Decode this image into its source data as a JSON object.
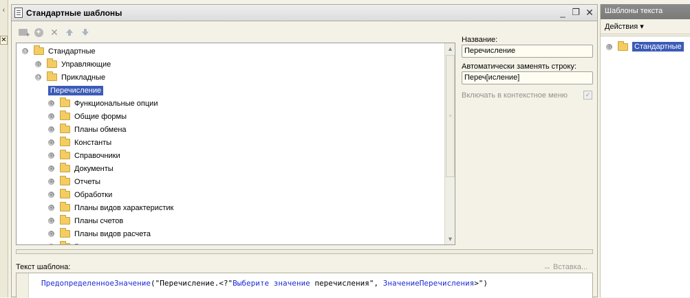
{
  "window": {
    "title": "Стандартные шаблоны",
    "minimize_icon": "_",
    "restore_icon": "❐",
    "close_icon": "✕"
  },
  "left_panel": {
    "collapse_icon": "‹",
    "close_icon": "✕"
  },
  "toolbar": {
    "items": [
      "add-folder-icon",
      "add-icon",
      "delete-icon",
      "move-up-icon",
      "move-down-icon"
    ]
  },
  "tree": {
    "rows": [
      {
        "label": "Стандартные",
        "expander": "⊖",
        "level": 0,
        "folder": true
      },
      {
        "label": "Управляющие",
        "expander": "⊕",
        "level": 1,
        "folder": true
      },
      {
        "label": "Прикладные",
        "expander": "⊖",
        "level": 1,
        "folder": true
      },
      {
        "label": "Перечисление",
        "expander": "",
        "level": 2,
        "folder": false,
        "selected": true
      },
      {
        "label": "Функциональные опции",
        "expander": "⊕",
        "level": 2,
        "folder": true
      },
      {
        "label": "Общие формы",
        "expander": "⊕",
        "level": 2,
        "folder": true
      },
      {
        "label": "Планы обмена",
        "expander": "⊕",
        "level": 2,
        "folder": true
      },
      {
        "label": "Константы",
        "expander": "⊕",
        "level": 2,
        "folder": true
      },
      {
        "label": "Справочники",
        "expander": "⊕",
        "level": 2,
        "folder": true
      },
      {
        "label": "Документы",
        "expander": "⊕",
        "level": 2,
        "folder": true
      },
      {
        "label": "Отчеты",
        "expander": "⊕",
        "level": 2,
        "folder": true
      },
      {
        "label": "Обработки",
        "expander": "⊕",
        "level": 2,
        "folder": true
      },
      {
        "label": "Планы видов характеристик",
        "expander": "⊕",
        "level": 2,
        "folder": true
      },
      {
        "label": "Планы счетов",
        "expander": "⊕",
        "level": 2,
        "folder": true
      },
      {
        "label": "Планы видов расчета",
        "expander": "⊕",
        "level": 2,
        "folder": true
      },
      {
        "label": "Бизнес-процессы",
        "expander": "⊕",
        "level": 2,
        "folder": true
      }
    ],
    "scroll_up_icon": "▲",
    "scroll_down_icon": "▼",
    "scroll_grip_icon": "≡"
  },
  "form": {
    "name_label": "Название:",
    "name_value": "Перечисление",
    "replace_label": "Автоматически заменять строку:",
    "replace_value": "Переч[исление]",
    "context_menu_label": "Включать в контекстное меню",
    "context_menu_checked": true,
    "check_icon": "✓"
  },
  "template": {
    "label": "Текст шаблона:",
    "insert_label": "↔ Вставка...",
    "code_func": "ПредопределенноеЗначение",
    "code_part1": "(\"Перечисление.<?\"",
    "code_part2": "Выберите значение",
    "code_part3": " перечисления\", ",
    "code_part4": "ЗначениеПеречисления",
    "code_part5": ">\")"
  },
  "dock": {
    "title": "Шаблоны текста",
    "actions_label": "Действия ▾",
    "tree_root_label": "Стандартные",
    "tree_root_expander": "⊕"
  },
  "colors": {
    "selection": "#3b5bb7",
    "folder": "#f3cc62",
    "keyword": "#1b2bd6",
    "background": "#f4f2e6"
  }
}
